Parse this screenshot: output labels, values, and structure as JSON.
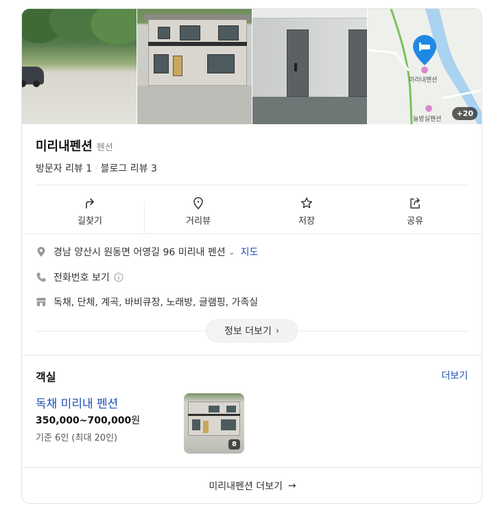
{
  "photos": {
    "more_count": "+20"
  },
  "map": {
    "pin_label": "미리내펜션",
    "nearby_label": "늘방실펜션"
  },
  "place": {
    "name": "미리내펜션",
    "category": "펜션",
    "visitor_reviews": "방문자 리뷰 1",
    "blog_reviews": "블로그 리뷰 3"
  },
  "actions": [
    {
      "label": "길찾기",
      "icon": "directions-icon"
    },
    {
      "label": "거리뷰",
      "icon": "street-view-icon"
    },
    {
      "label": "저장",
      "icon": "star-icon"
    },
    {
      "label": "공유",
      "icon": "share-icon"
    }
  ],
  "info": {
    "address": "경남 양산시 원동면 어영길 96 미리내 펜션",
    "map_link": "지도",
    "phone": "전화번호 보기",
    "amenities": "독채, 단체, 계곡, 바비큐장, 노래방, 글램핑, 가족실",
    "more_info": "정보 더보기"
  },
  "rooms": {
    "title": "객실",
    "more": "더보기",
    "item": {
      "name": "독채 미리내 펜션",
      "price": "350,000~700,000",
      "won": "원",
      "capacity": "기준 6인 (최대 20인)",
      "photo_count": "8"
    }
  },
  "footer": {
    "label": "미리내펜션 더보기"
  },
  "colors": {
    "link": "#1a4fb4",
    "pin": "#1e88e5",
    "river": "#a9d3f0"
  }
}
